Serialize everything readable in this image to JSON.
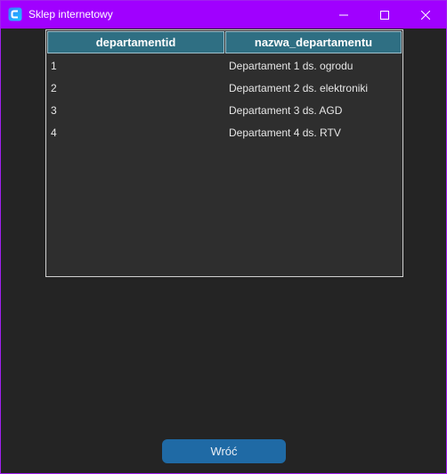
{
  "window": {
    "title": "Sklep internetowy",
    "accent_color": "#a000ff"
  },
  "title_controls": {
    "minimize_icon": "minimize-icon",
    "maximize_icon": "maximize-icon",
    "close_icon": "close-icon"
  },
  "table": {
    "columns": [
      "departamentid",
      "nazwa_departamentu"
    ],
    "rows": [
      {
        "id": "1",
        "name": "Departament 1 ds. ogrodu"
      },
      {
        "id": "2",
        "name": "Departament 2 ds. elektroniki"
      },
      {
        "id": "3",
        "name": "Departament 3 ds. AGD"
      },
      {
        "id": "4",
        "name": "Departament 4 ds. RTV"
      }
    ],
    "header_color": "#2f6f83"
  },
  "back_button": {
    "label": "Wróć",
    "color": "#1f6aa5"
  }
}
